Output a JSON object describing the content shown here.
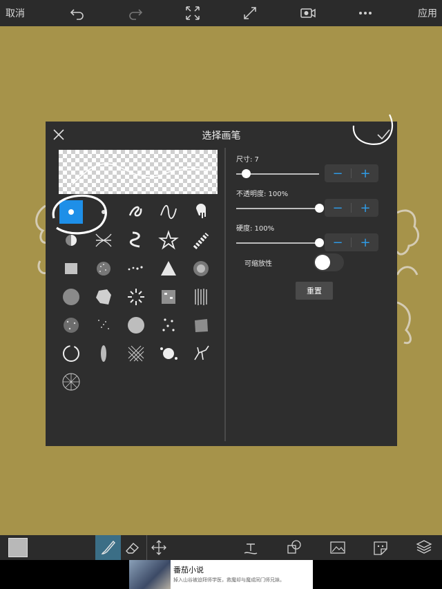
{
  "topbar": {
    "cancel_label": "取消",
    "apply_label": "应用",
    "icons": [
      "undo-icon",
      "redo-icon",
      "fit-screen-icon",
      "fullscreen-icon",
      "record-icon",
      "more-icon"
    ]
  },
  "dialog": {
    "title": "选择画笔",
    "size_label": "尺寸: 7",
    "size_value": 7,
    "opacity_label": "不透明度: 100%",
    "opacity_value": 100,
    "hardness_label": "硬度: 100%",
    "hardness_value": 100,
    "scalable_label": "可缩放性",
    "reset_label": "重置",
    "minus": "−",
    "plus": "+",
    "brushes": [
      "round-brush",
      "airbrush-dot",
      "scribble-brush",
      "wave-brush",
      "drip-brush",
      "sphere-brush",
      "ribbon-brush",
      "spiral-brush",
      "star-brush",
      "chain-brush",
      "streak-brush",
      "noise-brush",
      "dots-line-brush",
      "triangle-brush",
      "soft-brush",
      "grain-brush",
      "splatter-brush",
      "fireworks-brush",
      "square-noise-brush",
      "lines-brush",
      "speckle-brush",
      "spray-brush",
      "circle-fill-brush",
      "dots-brush",
      "rough-brush",
      "ring-brush",
      "leaf-brush",
      "crosshatch-brush",
      "burst-brush",
      "crack-brush",
      "radial-brush"
    ],
    "selected_brush": "round-brush"
  },
  "toolbar": {
    "icons": [
      "color-swatch",
      "brush-icon",
      "eraser-icon",
      "move-icon",
      "text-icon",
      "shape-icon",
      "image-icon",
      "sticker-icon",
      "layers-icon"
    ]
  },
  "ad": {
    "title": "番茄小说",
    "description": "掉入山谷被迫拜师学医，救魔却与魔成同门师兄妹。"
  },
  "colors": {
    "canvas": "#a6934a",
    "panel": "#2e2e2e",
    "accent": "#2f9be6",
    "selected_brush": "#1e8fe8"
  }
}
